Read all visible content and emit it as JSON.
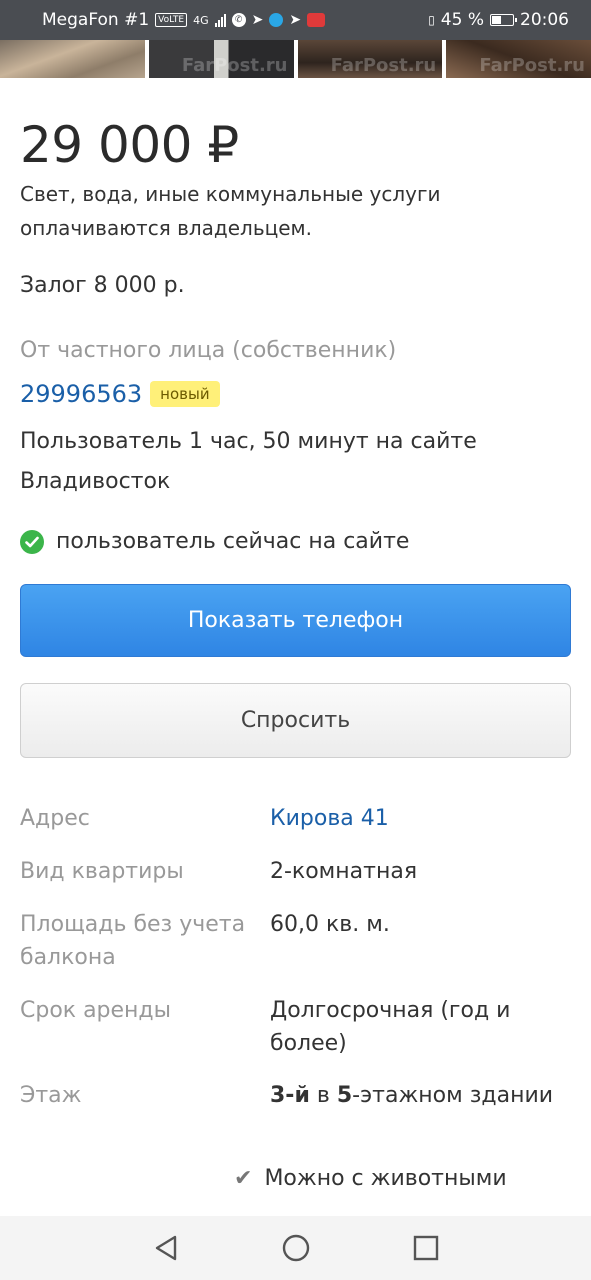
{
  "status_bar": {
    "carrier": "MegaFon #1",
    "volte": "VoLTE",
    "network": "4G",
    "battery": "45 %",
    "time": "20:06",
    "battery_level": 0.45
  },
  "photos": {
    "watermark": "FarPost.ru"
  },
  "listing": {
    "price": "29 000 ₽",
    "note": "Свет, вода, иные коммунальные услуги оплачиваются владельцем.",
    "deposit": "Залог 8 000 р.",
    "seller_type": "От частного лица (собственник)",
    "user_id": "29996563",
    "user_badge": "новый",
    "user_since": "Пользователь 1 час, 50 минут на сайте",
    "user_city": "Владивосток",
    "online_status": "пользователь сейчас на сайте"
  },
  "buttons": {
    "show_phone": "Показать телефон",
    "ask": "Спросить"
  },
  "specs": {
    "address_label": "Адрес",
    "address_value": "Кирова 41",
    "type_label": "Вид квартиры",
    "type_value": "2-комнатная",
    "area_label": "Площадь без учета балкона",
    "area_value": "60,0 кв. м.",
    "term_label": "Срок аренды",
    "term_value": "Долгосрочная (год и более)",
    "floor_label": "Этаж",
    "floor_num": "3-й",
    "floor_in": "в",
    "floor_total": "5",
    "floor_suffix": "-этажном здании",
    "pets": "Можно с животными"
  },
  "colors": {
    "primary_button": "#2f85e4",
    "link": "#1a5fa8",
    "badge": "#fff079",
    "online": "#3bb54a"
  }
}
